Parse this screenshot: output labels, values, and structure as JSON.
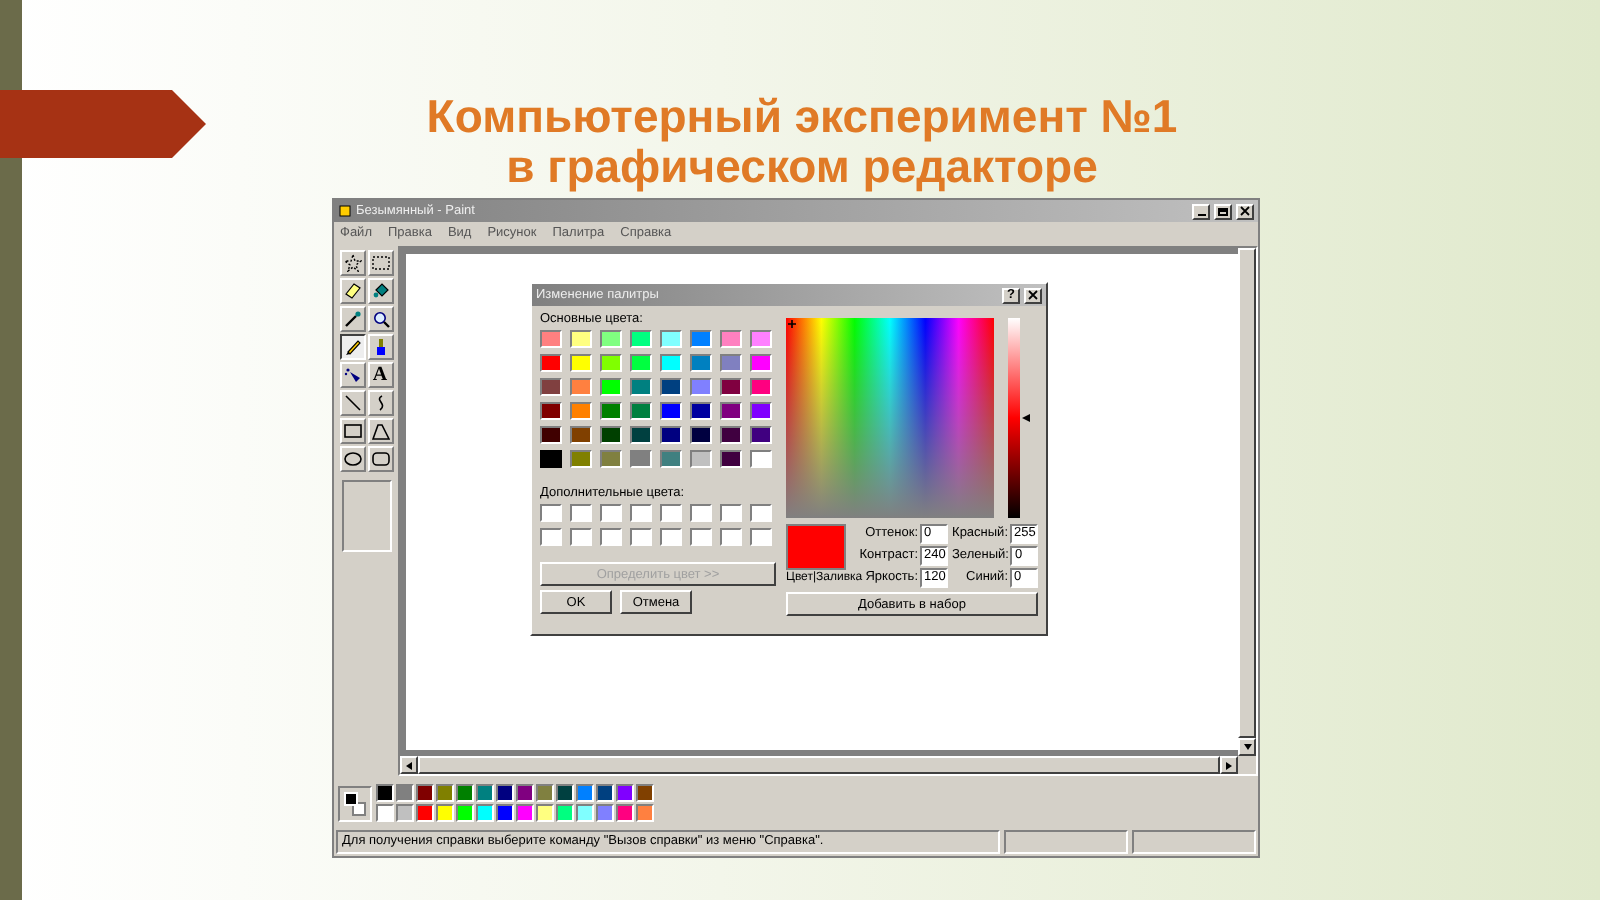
{
  "slide": {
    "title_lines": [
      "Компьютерный эксперимент №1",
      "в графическом редакторе"
    ]
  },
  "window": {
    "title": "Безымянный - Paint"
  },
  "menu": [
    "Файл",
    "Правка",
    "Вид",
    "Рисунок",
    "Палитра",
    "Справка"
  ],
  "tools": [
    {
      "kind": "free-select",
      "selected": false
    },
    {
      "kind": "rect-select",
      "selected": false
    },
    {
      "kind": "eraser",
      "selected": false
    },
    {
      "kind": "fill",
      "selected": false
    },
    {
      "kind": "picker",
      "selected": false
    },
    {
      "kind": "magnifier",
      "selected": false
    },
    {
      "kind": "pencil",
      "selected": true
    },
    {
      "kind": "brush",
      "selected": false
    },
    {
      "kind": "airbrush",
      "selected": false
    },
    {
      "kind": "text",
      "label": "A",
      "selected": false
    },
    {
      "kind": "line",
      "selected": false
    },
    {
      "kind": "curve",
      "selected": false
    },
    {
      "kind": "rectangle",
      "selected": false
    },
    {
      "kind": "polygon",
      "selected": false
    },
    {
      "kind": "ellipse",
      "selected": false
    },
    {
      "kind": "rounded-rect",
      "selected": false
    }
  ],
  "current_colors": [
    {
      "color": "#000000"
    },
    {
      "color": "#ffffff"
    }
  ],
  "palette": [
    {
      "color": "#000000"
    },
    {
      "color": "#808080"
    },
    {
      "color": "#800000"
    },
    {
      "color": "#808000"
    },
    {
      "color": "#008000"
    },
    {
      "color": "#008080"
    },
    {
      "color": "#000080"
    },
    {
      "color": "#800080"
    },
    {
      "color": "#808040"
    },
    {
      "color": "#004040"
    },
    {
      "color": "#0080ff"
    },
    {
      "color": "#004080"
    },
    {
      "color": "#8000ff"
    },
    {
      "color": "#804000"
    },
    {
      "color": "#ffffff"
    },
    {
      "color": "#c0c0c0"
    },
    {
      "color": "#ff0000"
    },
    {
      "color": "#ffff00"
    },
    {
      "color": "#00ff00"
    },
    {
      "color": "#00ffff"
    },
    {
      "color": "#0000ff"
    },
    {
      "color": "#ff00ff"
    },
    {
      "color": "#ffff80"
    },
    {
      "color": "#00ff80"
    },
    {
      "color": "#80ffff"
    },
    {
      "color": "#8080ff"
    },
    {
      "color": "#ff0080"
    },
    {
      "color": "#ff8040"
    }
  ],
  "status_bar": {
    "text": "Для получения справки выберите команду \"Вызов справки\" из меню \"Справка\"."
  },
  "dialog": {
    "title": "Изменение палитры",
    "help": "?",
    "basic_label": "Основные цвета:",
    "basic_colors": [
      {
        "color": "#ff8080",
        "selected": false
      },
      {
        "color": "#ffff80",
        "selected": false
      },
      {
        "color": "#80ff80",
        "selected": false
      },
      {
        "color": "#00ff80",
        "selected": false
      },
      {
        "color": "#80ffff",
        "selected": false
      },
      {
        "color": "#0080ff",
        "selected": false
      },
      {
        "color": "#ff80c0",
        "selected": false
      },
      {
        "color": "#ff80ff",
        "selected": false
      },
      {
        "color": "#ff0000",
        "selected": false
      },
      {
        "color": "#ffff00",
        "selected": false
      },
      {
        "color": "#80ff00",
        "selected": false
      },
      {
        "color": "#00ff40",
        "selected": false
      },
      {
        "color": "#00ffff",
        "selected": false
      },
      {
        "color": "#0080c0",
        "selected": false
      },
      {
        "color": "#8080c0",
        "selected": false
      },
      {
        "color": "#ff00ff",
        "selected": false
      },
      {
        "color": "#804040",
        "selected": false
      },
      {
        "color": "#ff8040",
        "selected": false
      },
      {
        "color": "#00ff00",
        "selected": false
      },
      {
        "color": "#008080",
        "selected": false
      },
      {
        "color": "#004080",
        "selected": false
      },
      {
        "color": "#8080ff",
        "selected": false
      },
      {
        "color": "#800040",
        "selected": false
      },
      {
        "color": "#ff0080",
        "selected": false
      },
      {
        "color": "#800000",
        "selected": false
      },
      {
        "color": "#ff8000",
        "selected": false
      },
      {
        "color": "#008000",
        "selected": false
      },
      {
        "color": "#008040",
        "selected": false
      },
      {
        "color": "#0000ff",
        "selected": false
      },
      {
        "color": "#0000a0",
        "selected": false
      },
      {
        "color": "#800080",
        "selected": false
      },
      {
        "color": "#8000ff",
        "selected": false
      },
      {
        "color": "#400000",
        "selected": false
      },
      {
        "color": "#804000",
        "selected": false
      },
      {
        "color": "#004000",
        "selected": false
      },
      {
        "color": "#004040",
        "selected": false
      },
      {
        "color": "#000080",
        "selected": false
      },
      {
        "color": "#000040",
        "selected": false
      },
      {
        "color": "#400040",
        "selected": false
      },
      {
        "color": "#400080",
        "selected": false
      },
      {
        "color": "#000000",
        "selected": true
      },
      {
        "color": "#808000",
        "selected": false
      },
      {
        "color": "#808040",
        "selected": false
      },
      {
        "color": "#808080",
        "selected": false
      },
      {
        "color": "#408080",
        "selected": false
      },
      {
        "color": "#c0c0c0",
        "selected": false
      },
      {
        "color": "#400040",
        "selected": false
      },
      {
        "color": "#ffffff",
        "selected": false
      }
    ],
    "custom_label": "Дополнительные цвета:",
    "custom_colors": [
      {
        "color": "#ffffff"
      },
      {
        "color": "#ffffff"
      },
      {
        "color": "#ffffff"
      },
      {
        "color": "#ffffff"
      },
      {
        "color": "#ffffff"
      },
      {
        "color": "#ffffff"
      },
      {
        "color": "#ffffff"
      },
      {
        "color": "#ffffff"
      },
      {
        "color": "#ffffff"
      },
      {
        "color": "#ffffff"
      },
      {
        "color": "#ffffff"
      },
      {
        "color": "#ffffff"
      },
      {
        "color": "#ffffff"
      },
      {
        "color": "#ffffff"
      },
      {
        "color": "#ffffff"
      },
      {
        "color": "#ffffff"
      }
    ],
    "define_button": {
      "label": "Определить цвет >>",
      "disabled": true
    },
    "ok_button": "OK",
    "cancel_button": "Отмена",
    "preview": {
      "color": "#ff0000",
      "label": "Цвет|Заливка"
    },
    "fields": [
      {
        "label": "Оттенок:",
        "value": "0"
      },
      {
        "label": "Красный:",
        "value": "255"
      },
      {
        "label": "Контраст:",
        "value": "240"
      },
      {
        "label": "Зеленый:",
        "value": "0"
      },
      {
        "label": "Яркость:",
        "value": "120"
      },
      {
        "label": "Синий:",
        "value": "0"
      }
    ],
    "add_button": "Добавить в набор"
  }
}
